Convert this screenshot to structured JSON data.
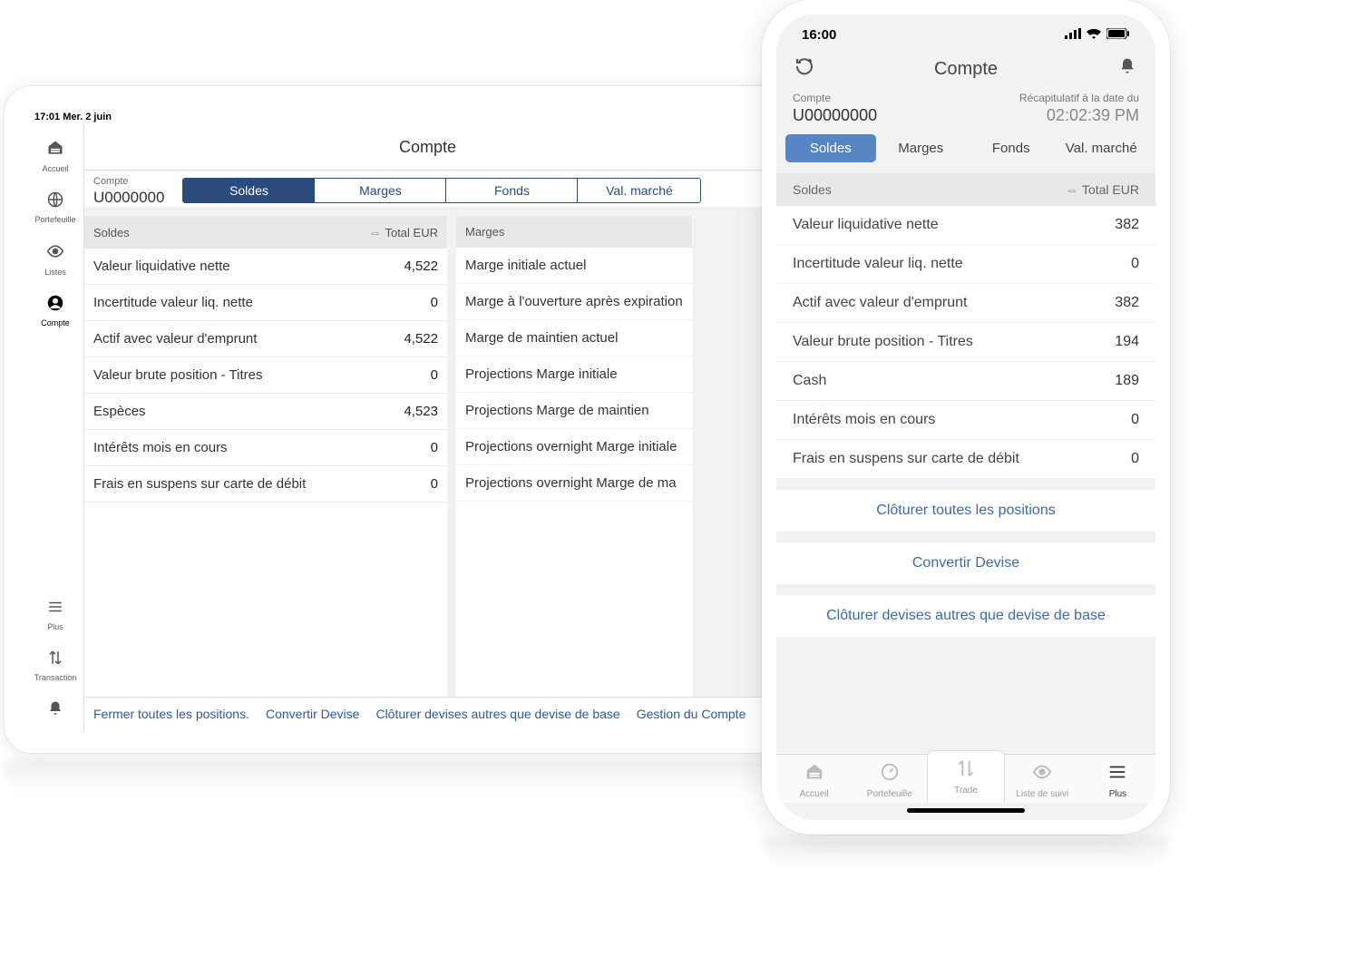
{
  "tablet": {
    "statusbar": "17:01  Mer. 2 juin",
    "title": "Compte",
    "sidebar": {
      "items": [
        {
          "label": "Accueil"
        },
        {
          "label": "Portefeuille"
        },
        {
          "label": "Listes"
        },
        {
          "label": "Compte"
        }
      ],
      "bottom": [
        {
          "label": "Plus"
        },
        {
          "label": "Transaction"
        }
      ]
    },
    "account_small_label": "Compte",
    "account_number": "U0000000",
    "segments": {
      "soldes": "Soldes",
      "marges": "Marges",
      "fonds": "Fonds",
      "valmarche": "Val. marché"
    },
    "panel_soldes": {
      "header": "Soldes",
      "total_label": "Total EUR",
      "rows": [
        {
          "label": "Valeur liquidative nette",
          "value": "4,522"
        },
        {
          "label": "Incertitude valeur liq. nette",
          "value": "0"
        },
        {
          "label": "Actif avec valeur d'emprunt",
          "value": "4,522"
        },
        {
          "label": "Valeur brute position - Titres",
          "value": "0"
        },
        {
          "label": "Espèces",
          "value": "4,523"
        },
        {
          "label": "Intérêts mois en cours",
          "value": "0"
        },
        {
          "label": "Frais en suspens sur carte de débit",
          "value": "0"
        }
      ]
    },
    "panel_marges": {
      "header": "Marges",
      "rows": [
        {
          "label": "Marge initiale actuel"
        },
        {
          "label": "Marge à l'ouverture après expiration"
        },
        {
          "label": "Marge de maintien actuel"
        },
        {
          "label": "Projections Marge initiale"
        },
        {
          "label": "Projections Marge de maintien"
        },
        {
          "label": "Projections overnight Marge initiale"
        },
        {
          "label": "Projections overnight Marge de ma"
        }
      ]
    },
    "footer_links": {
      "close_all": "Fermer toutes les positions.",
      "convert": "Convertir Devise",
      "close_fx": "Clôturer devises autres que devise de base",
      "manage": "Gestion du Compte"
    }
  },
  "phone": {
    "statusbar_time": "16:00",
    "title": "Compte",
    "account_small_label": "Compte",
    "account_number": "U00000000",
    "summary_label": "Récapitulatif à la date du",
    "summary_time": "02:02:39 PM",
    "segments": {
      "soldes": "Soldes",
      "marges": "Marges",
      "fonds": "Fonds",
      "valmarche": "Val. marché"
    },
    "section_header": "Soldes",
    "total_label": "Total EUR",
    "rows": [
      {
        "label": "Valeur liquidative nette",
        "value": "382"
      },
      {
        "label": "Incertitude valeur liq. nette",
        "value": "0"
      },
      {
        "label": "Actif avec valeur d'emprunt",
        "value": "382"
      },
      {
        "label": "Valeur brute position - Titres",
        "value": "194"
      },
      {
        "label": "Cash",
        "value": "189"
      },
      {
        "label": "Intérêts mois en cours",
        "value": "0"
      },
      {
        "label": "Frais en suspens sur carte de débit",
        "value": "0"
      }
    ],
    "actions": {
      "close_all": "Clôturer toutes les positions",
      "convert": "Convertir Devise",
      "close_fx": "Clôturer devises autres que devise de base"
    },
    "tabbar": {
      "accueil": "Accueil",
      "portefeuille": "Portefeuille",
      "trade": "Trade",
      "liste": "Liste de suivi",
      "plus": "Plus"
    }
  }
}
